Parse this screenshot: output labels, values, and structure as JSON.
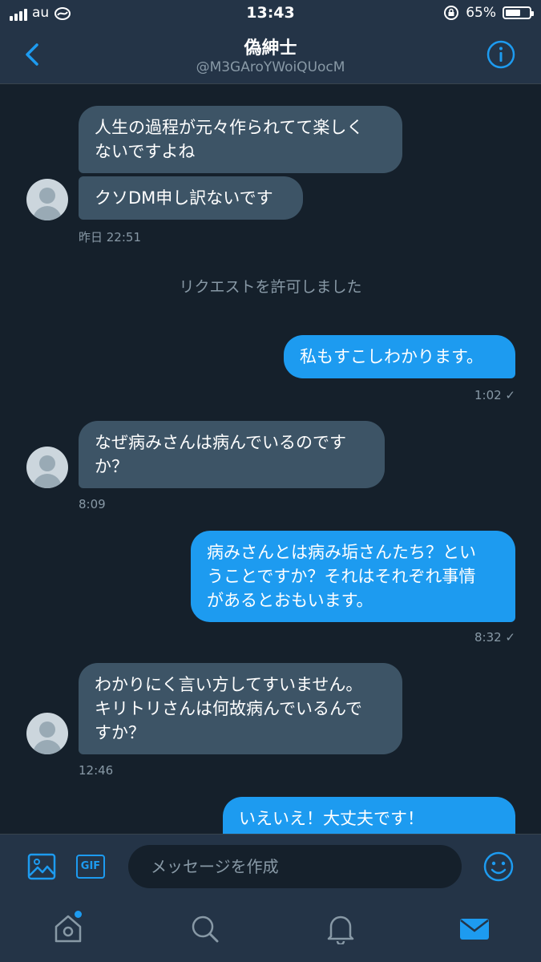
{
  "status_bar": {
    "carrier": "au",
    "time": "13:43",
    "battery": "65%",
    "battery_level": 0.65
  },
  "header": {
    "title": "偽紳士",
    "handle": "@M3GAroYWoiQUocM"
  },
  "conversation": {
    "groups": [
      {
        "from": "them",
        "bubbles": [
          "人生の過程が元々作られてて楽しく\nないですよね",
          "クソDM申し訳ないです"
        ],
        "timestamp": "昨日 22:51"
      },
      {
        "system": "リクエストを許可しました"
      },
      {
        "from": "me",
        "bubbles": [
          "私もすこしわかります。"
        ],
        "timestamp": "1:02 ✓"
      },
      {
        "from": "them",
        "bubbles": [
          "なぜ病みさんは病んでいるのです\nか？"
        ],
        "timestamp": "8:09"
      },
      {
        "from": "me",
        "bubbles": [
          "病みさんとは病み垢さんたち？とい\nうことですか？それはそれぞれ事情\nがあるとおもいます。"
        ],
        "timestamp": "8:32 ✓"
      },
      {
        "from": "them",
        "bubbles": [
          "わかりにく言い方してすいません。\nキリトリさんは何故病んでいるんで\nすか？"
        ],
        "timestamp": "12:46"
      },
      {
        "from": "me",
        "bubbles": [
          "いえいえ！大丈夫です！\n"
        ]
      }
    ]
  },
  "composer": {
    "gif_label": "GIF",
    "placeholder": "メッセージを作成"
  },
  "tabs": [
    "home",
    "search",
    "notifications",
    "messages"
  ],
  "colors": {
    "background": "#15202b",
    "bar": "#243447",
    "accent": "#1d9bf0",
    "incoming": "#3d5466",
    "muted": "#8899a6"
  }
}
